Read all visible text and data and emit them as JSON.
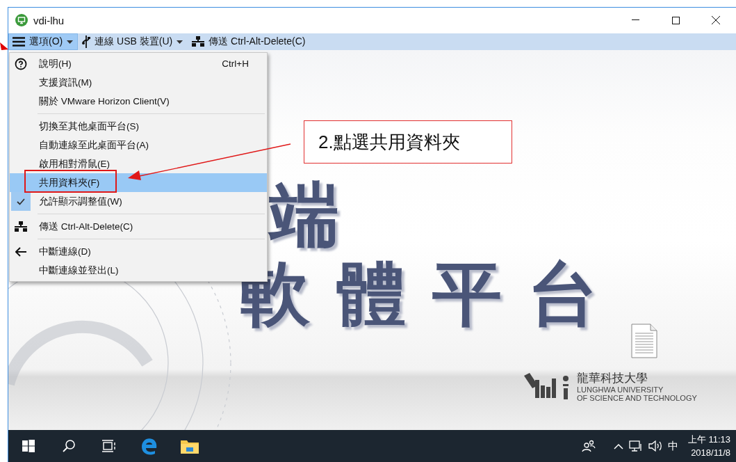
{
  "window": {
    "title": "vdi-lhu"
  },
  "toolbar": [
    {
      "kind": "menu",
      "label": "選項(O)",
      "selected": true
    },
    {
      "kind": "menu",
      "label": "連線 USB 裝置(U)",
      "selected": false
    },
    {
      "kind": "button",
      "label": "傳送 Ctrl-Alt-Delete(C)",
      "selected": false
    }
  ],
  "menu": {
    "sections": [
      [
        {
          "label": "說明(H)",
          "shortcut": "Ctrl+H",
          "selected": false,
          "checked": false
        },
        {
          "label": "支援資訊(M)",
          "selected": false,
          "checked": false
        },
        {
          "label": "關於 VMware Horizon Client(V)",
          "selected": false,
          "checked": false
        }
      ],
      [
        {
          "label": "切換至其他桌面平台(S)",
          "selected": false,
          "checked": false
        },
        {
          "label": "自動連線至此桌面平台(A)",
          "selected": false,
          "checked": false
        },
        {
          "label": "啟用相對滑鼠(E)",
          "selected": false,
          "checked": false
        },
        {
          "label": "共用資料夾(F)",
          "selected": true,
          "checked": false
        },
        {
          "label": "允許顯示調整值(W)",
          "selected": false,
          "checked": true
        }
      ],
      [
        {
          "label": "傳送 Ctrl-Alt-Delete(C)",
          "selected": false,
          "checked": false
        }
      ],
      [
        {
          "label": "中斷連線(D)",
          "selected": false,
          "checked": false
        },
        {
          "label": "中斷連線並登出(L)",
          "selected": false,
          "checked": false
        }
      ]
    ]
  },
  "annotation": {
    "text": "2.點選共用資料夾"
  },
  "wallpaper": {
    "headline_top": "端",
    "headline_bottom": "軟體平台",
    "school_name": "龍華科技大學",
    "school_english": [
      "LUNGHWA UNIVERSITY",
      "OF SCIENCE AND TECHNOLOGY"
    ]
  },
  "taskbar": {
    "ime": "中",
    "time": "上午 11:13",
    "date": "2018/11/8"
  }
}
